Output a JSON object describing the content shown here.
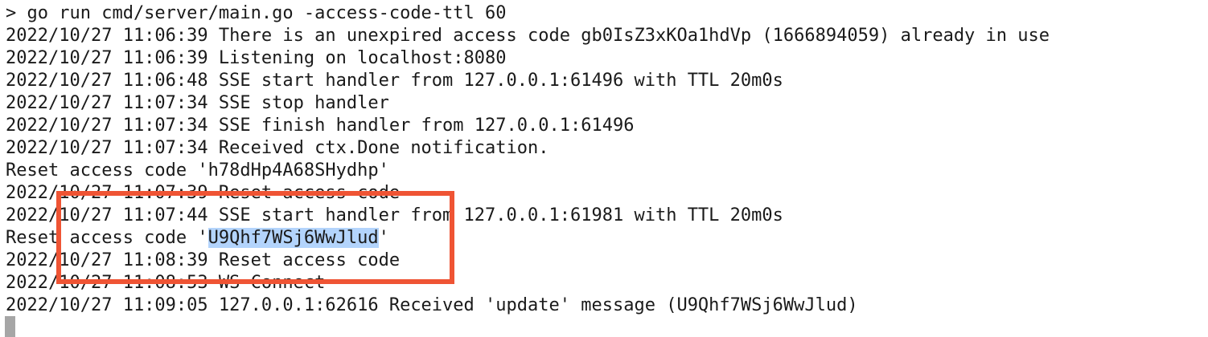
{
  "terminal": {
    "command": "> go run cmd/server/main.go -access-code-ttl 60",
    "lines": [
      "2022/10/27 11:06:39 There is an unexpired access code gb0IsZ3xKOa1hdVp (1666894059) already in use",
      "2022/10/27 11:06:39 Listening on localhost:8080",
      "2022/10/27 11:06:48 SSE start handler from 127.0.0.1:61496 with TTL 20m0s",
      "2022/10/27 11:07:34 SSE stop handler",
      "2022/10/27 11:07:34 SSE finish handler from 127.0.0.1:61496",
      "2022/10/27 11:07:34 Received ctx.Done notification.",
      "Reset access code 'h78dHp4A68SHydhp'",
      "2022/10/27 11:07:39 Reset access code",
      "2022/10/27 11:07:44 SSE start handler from 127.0.0.1:61981 with TTL 20m0s"
    ],
    "reset_line": {
      "prefix": "Reset access code '",
      "selected": "U9Qhf7WSj6WwJlud",
      "suffix": "'"
    },
    "lines_after": [
      "2022/10/27 11:08:39 Reset access code",
      "2022/10/27 11:08:53 WS Connect",
      "2022/10/27 11:09:05 127.0.0.1:62616 Received 'update' message (U9Qhf7WSj6WwJlud)"
    ]
  },
  "colors": {
    "background": "#ffffff",
    "text": "#1a1a1a",
    "selection": "#b3d4fc",
    "annotation_box": "#ef5434",
    "cursor": "#a6a6a6"
  }
}
